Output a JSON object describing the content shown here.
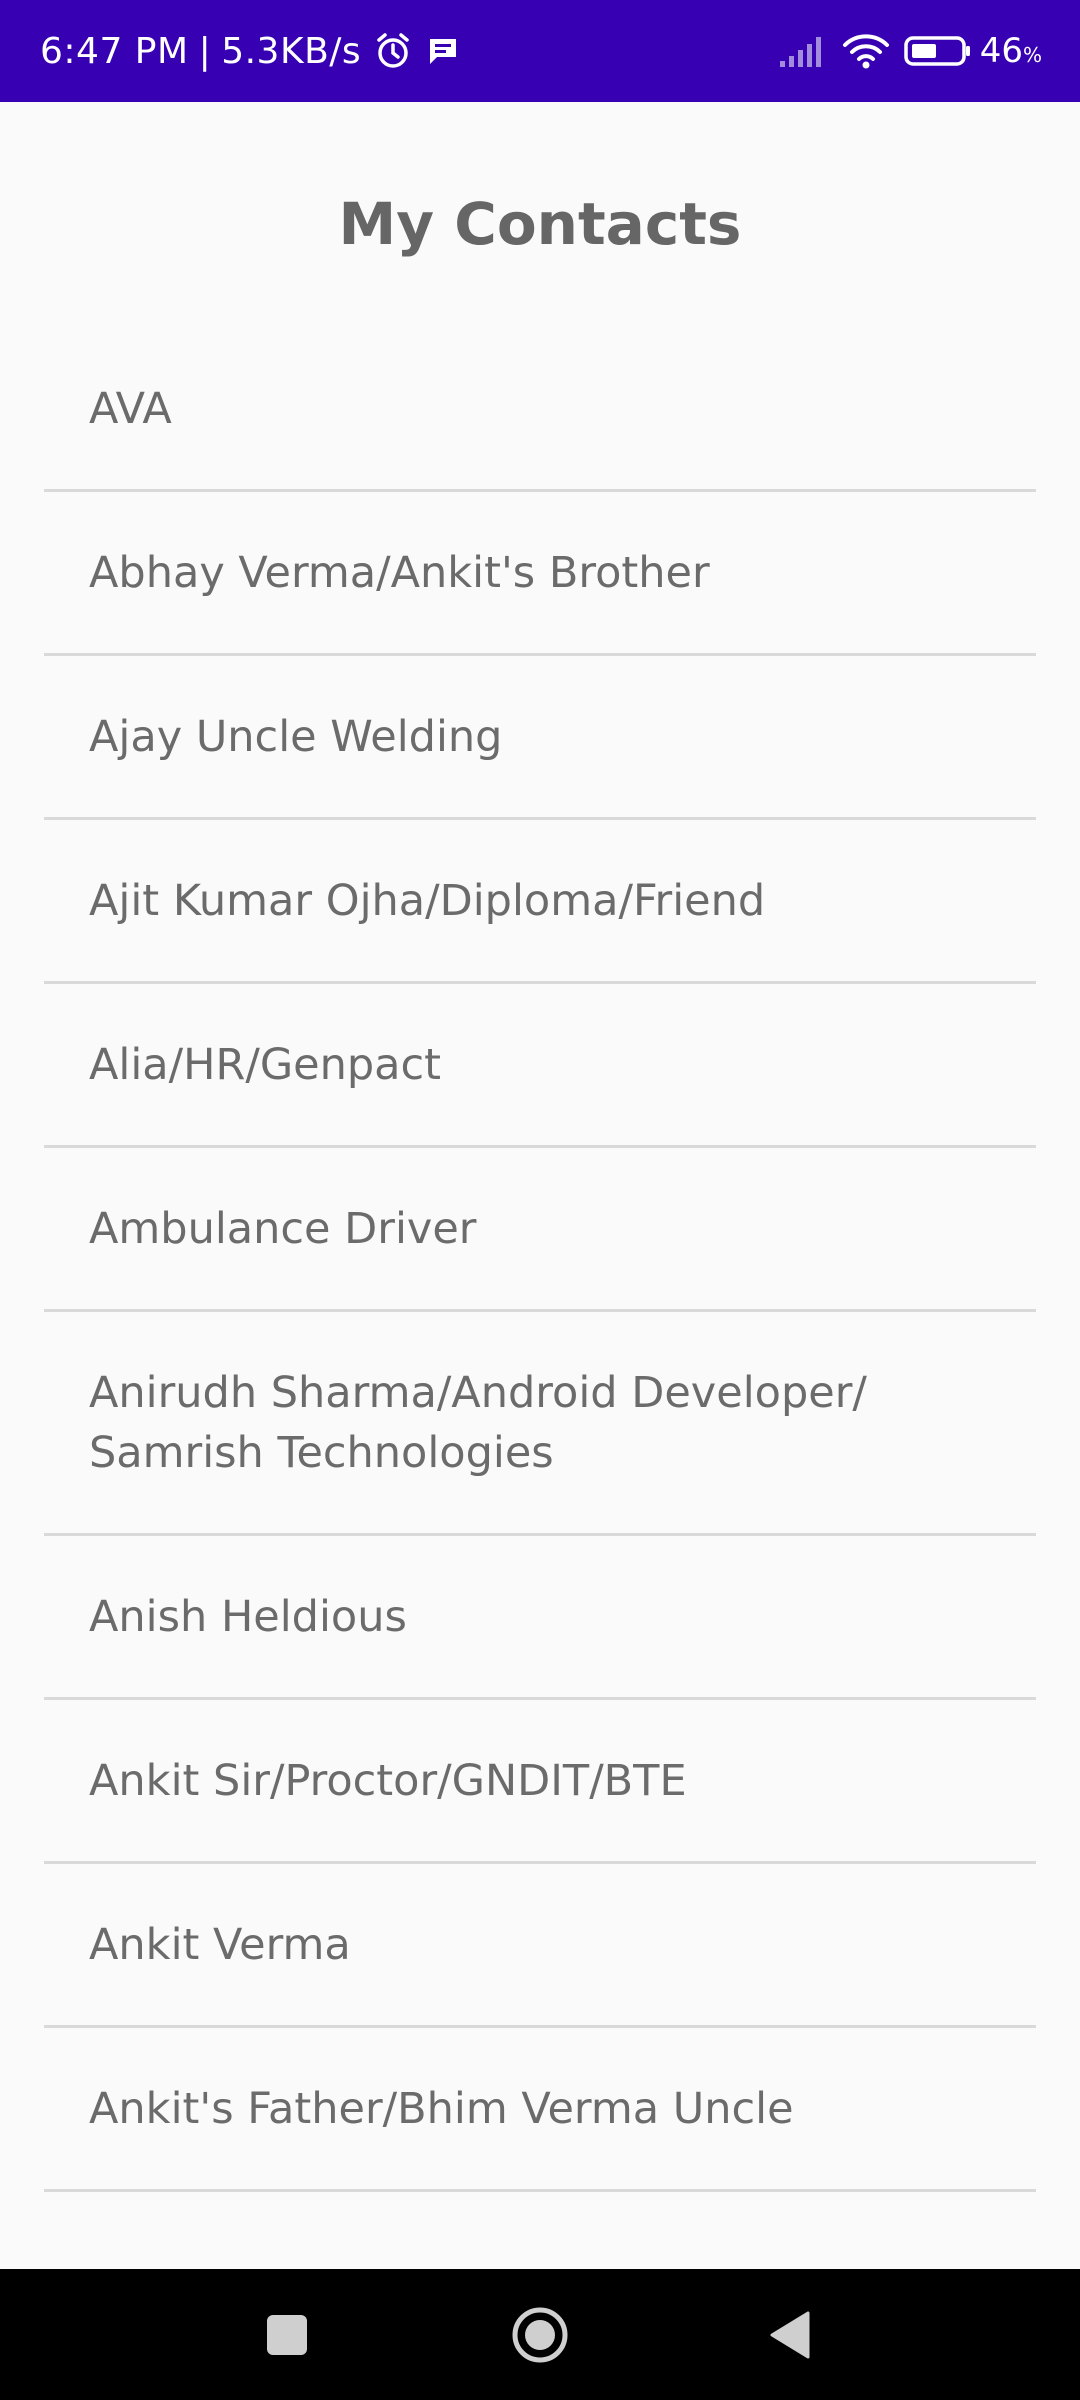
{
  "status_bar": {
    "time": "6:47 PM",
    "separator": "|",
    "network_speed": "5.3KB/s",
    "battery_level": "46",
    "battery_unit": "%",
    "icons": [
      "alarm-icon",
      "message-icon",
      "signal-icon",
      "wifi-icon",
      "battery-icon"
    ],
    "background_color": "#3700b3"
  },
  "header": {
    "title": "My Contacts"
  },
  "contacts": [
    "AVA",
    "Abhay Verma/Ankit's Brother",
    "Ajay Uncle Welding",
    "Ajit Kumar Ojha/Diploma/Friend",
    "Alia/HR/Genpact",
    "Ambulance Driver",
    "Anirudh Sharma/Android Developer/ Samrish Technologies",
    "Anish Heldious",
    "Ankit Sir/Proctor/GNDIT/BTE",
    "Ankit Verma",
    "Ankit's Father/Bhim Verma Uncle"
  ],
  "nav_bar": {
    "buttons": [
      "recents-icon",
      "home-icon",
      "back-icon"
    ]
  },
  "colors": {
    "background": "#fafafa",
    "text": "#6b6b6b",
    "divider": "#d9d9d9",
    "nav_background": "#000000"
  }
}
